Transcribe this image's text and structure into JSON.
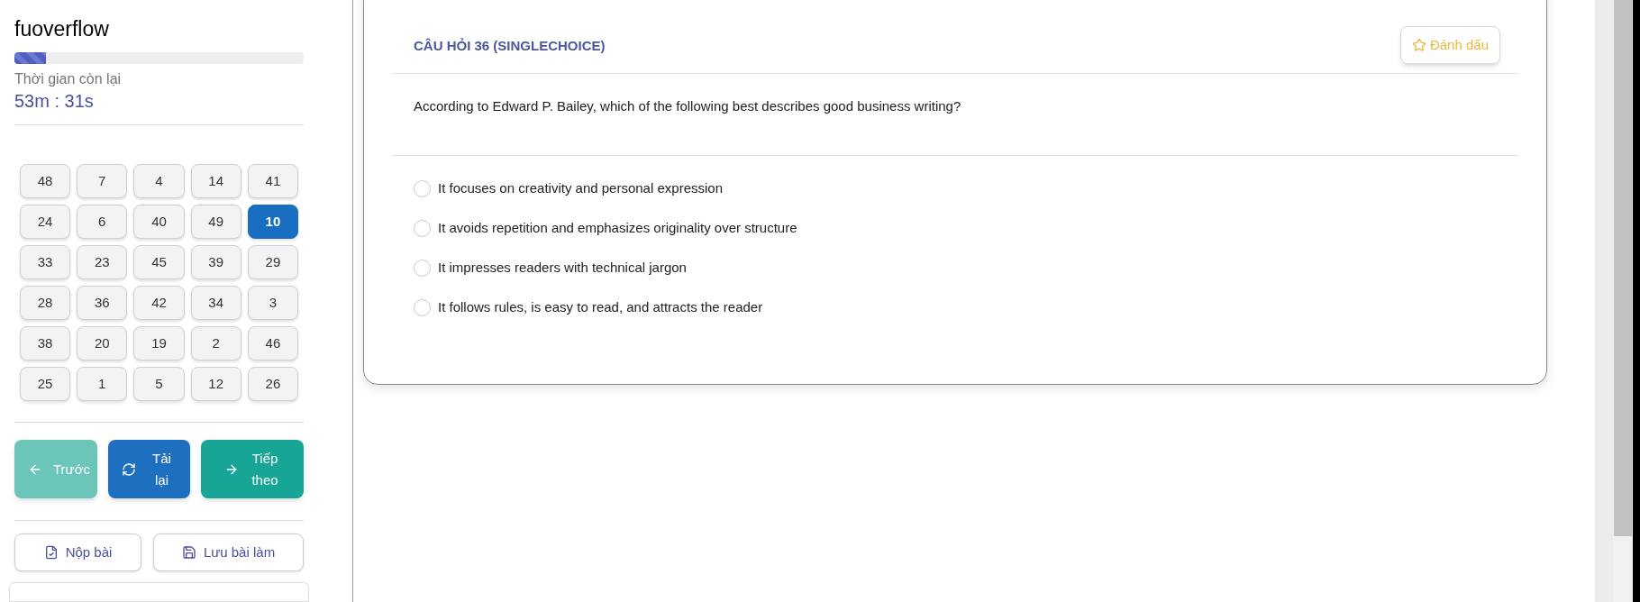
{
  "sidebar": {
    "title": "fuoverflow",
    "progress": {
      "level": 0.11
    },
    "time_label": "Thời gian còn lại",
    "time_value": "53m : 31s",
    "questions": [
      {
        "label": "48",
        "selected": false
      },
      {
        "label": "7",
        "selected": false
      },
      {
        "label": "4",
        "selected": false
      },
      {
        "label": "14",
        "selected": false
      },
      {
        "label": "41",
        "selected": false
      },
      {
        "label": "24",
        "selected": false
      },
      {
        "label": "6",
        "selected": false
      },
      {
        "label": "40",
        "selected": false
      },
      {
        "label": "49",
        "selected": false
      },
      {
        "label": "10",
        "selected": true
      },
      {
        "label": "33",
        "selected": false
      },
      {
        "label": "23",
        "selected": false
      },
      {
        "label": "45",
        "selected": false
      },
      {
        "label": "39",
        "selected": false
      },
      {
        "label": "29",
        "selected": false
      },
      {
        "label": "28",
        "selected": false
      },
      {
        "label": "36",
        "selected": false
      },
      {
        "label": "42",
        "selected": false
      },
      {
        "label": "34",
        "selected": false
      },
      {
        "label": "3",
        "selected": false
      },
      {
        "label": "38",
        "selected": false
      },
      {
        "label": "20",
        "selected": false
      },
      {
        "label": "19",
        "selected": false
      },
      {
        "label": "2",
        "selected": false
      },
      {
        "label": "46",
        "selected": false
      },
      {
        "label": "25",
        "selected": false
      },
      {
        "label": "1",
        "selected": false
      },
      {
        "label": "5",
        "selected": false
      },
      {
        "label": "12",
        "selected": false
      },
      {
        "label": "26",
        "selected": false
      }
    ],
    "nav_buttons": [
      {
        "kind": "previous",
        "label": "Trước"
      },
      {
        "kind": "reload",
        "label": "Tải lại"
      },
      {
        "kind": "next",
        "label": "Tiếp theo"
      }
    ],
    "action_buttons": [
      {
        "kind": "submit",
        "label": "Nộp bài"
      },
      {
        "kind": "save",
        "label": "Lưu bài làm"
      }
    ]
  },
  "question": {
    "heading": "CÂU HỎI 36 (SINGLECHOICE)",
    "bookmark": "Đánh dấu",
    "text": "According to Edward P. Bailey, which of the following best describes good business writing?",
    "options": [
      {
        "label": "It focuses on creativity and personal expression",
        "selected": false
      },
      {
        "label": "It avoids repetition and emphasizes originality over structure",
        "selected": false
      },
      {
        "label": "It impresses readers with technical jargon",
        "selected": false
      },
      {
        "label": "It follows rules, is easy to read, and attracts the reader",
        "selected": false
      }
    ]
  }
}
